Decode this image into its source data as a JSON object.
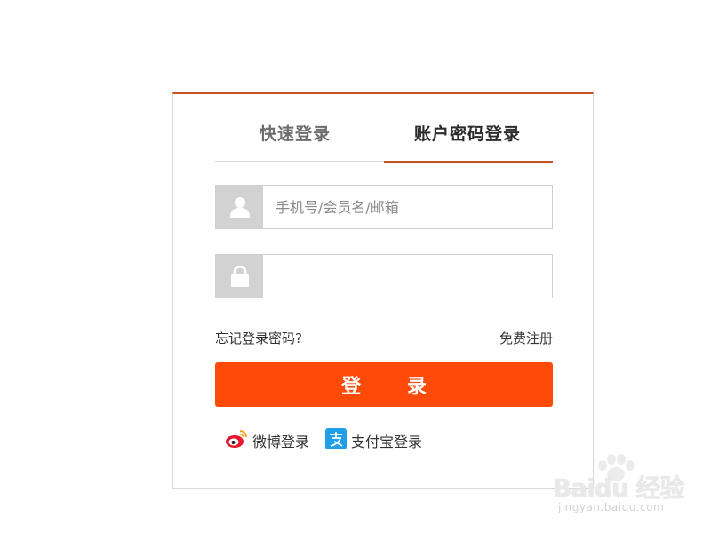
{
  "tabs": {
    "quick_login": "快速登录",
    "password_login": "账户密码登录",
    "active": "password_login"
  },
  "username": {
    "placeholder": "手机号/会员名/邮箱",
    "value": "",
    "icon": "user-icon"
  },
  "password": {
    "placeholder": "",
    "value": "",
    "icon": "lock-icon"
  },
  "links": {
    "forgot_password": "忘记登录密码?",
    "register": "免费注册"
  },
  "login_button": "登 录",
  "social": [
    {
      "label": "微博登录",
      "icon": "weibo-icon"
    },
    {
      "label": "支付宝登录",
      "icon": "alipay-icon"
    }
  ],
  "watermark": {
    "brand": "Baidu 经验",
    "url": "jingyan.baidu.com"
  },
  "colors": {
    "accent": "#ff4a0a",
    "tab_underline": "#c4502a",
    "icon_bg": "#d2d2d2"
  }
}
